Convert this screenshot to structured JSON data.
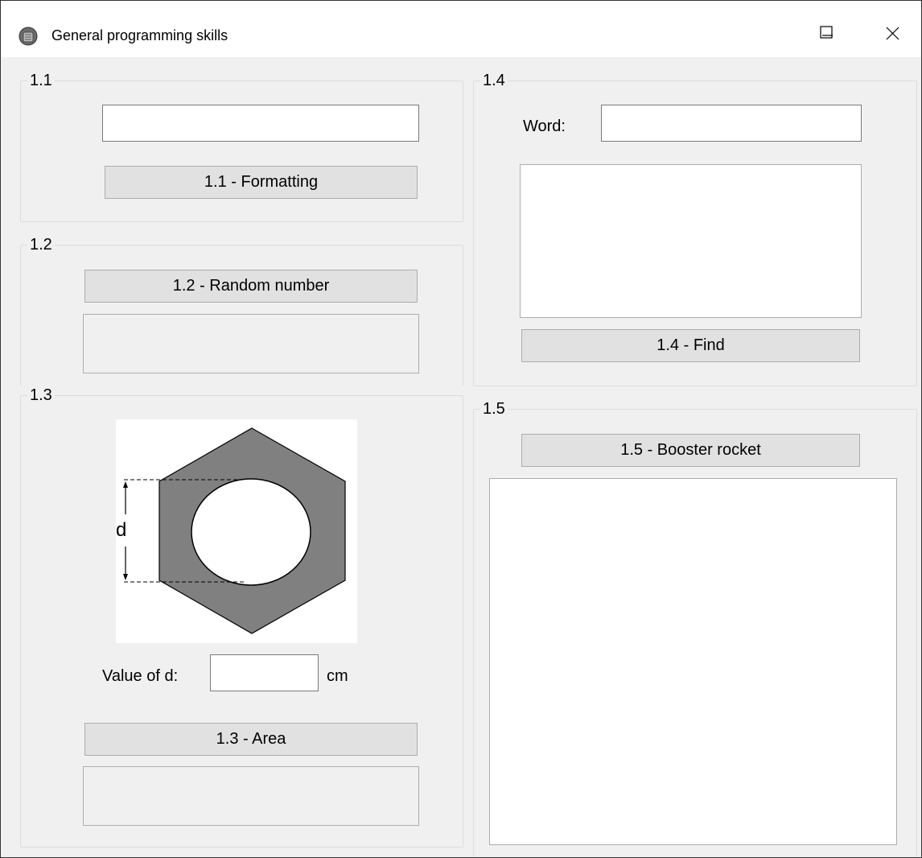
{
  "window": {
    "title": "General programming skills",
    "controls": [
      "minimize-icon",
      "maximize-icon",
      "close-icon"
    ]
  },
  "group_1_1": {
    "legend": "1.1",
    "input_value": "",
    "button_label": "1.1 - Formatting"
  },
  "group_1_2": {
    "legend": "1.2",
    "button_label": "1.2 - Random number",
    "output_text": ""
  },
  "group_1_3": {
    "legend": "1.3",
    "diagram_label": "d",
    "value_label": "Value of d:",
    "value_input": "",
    "unit_label": "cm",
    "button_label": "1.3 - Area",
    "output_text": ""
  },
  "group_1_4": {
    "legend": "1.4",
    "word_label": "Word:",
    "word_input": "",
    "list_items": [],
    "button_label": "1.4 - Find"
  },
  "group_1_5": {
    "legend": "1.5",
    "button_label": "1.5 - Booster rocket",
    "list_items": []
  },
  "colors": {
    "window_bg": "#f0f0f0",
    "button_bg": "#e1e1e1",
    "hexagon_fill": "#808080"
  }
}
